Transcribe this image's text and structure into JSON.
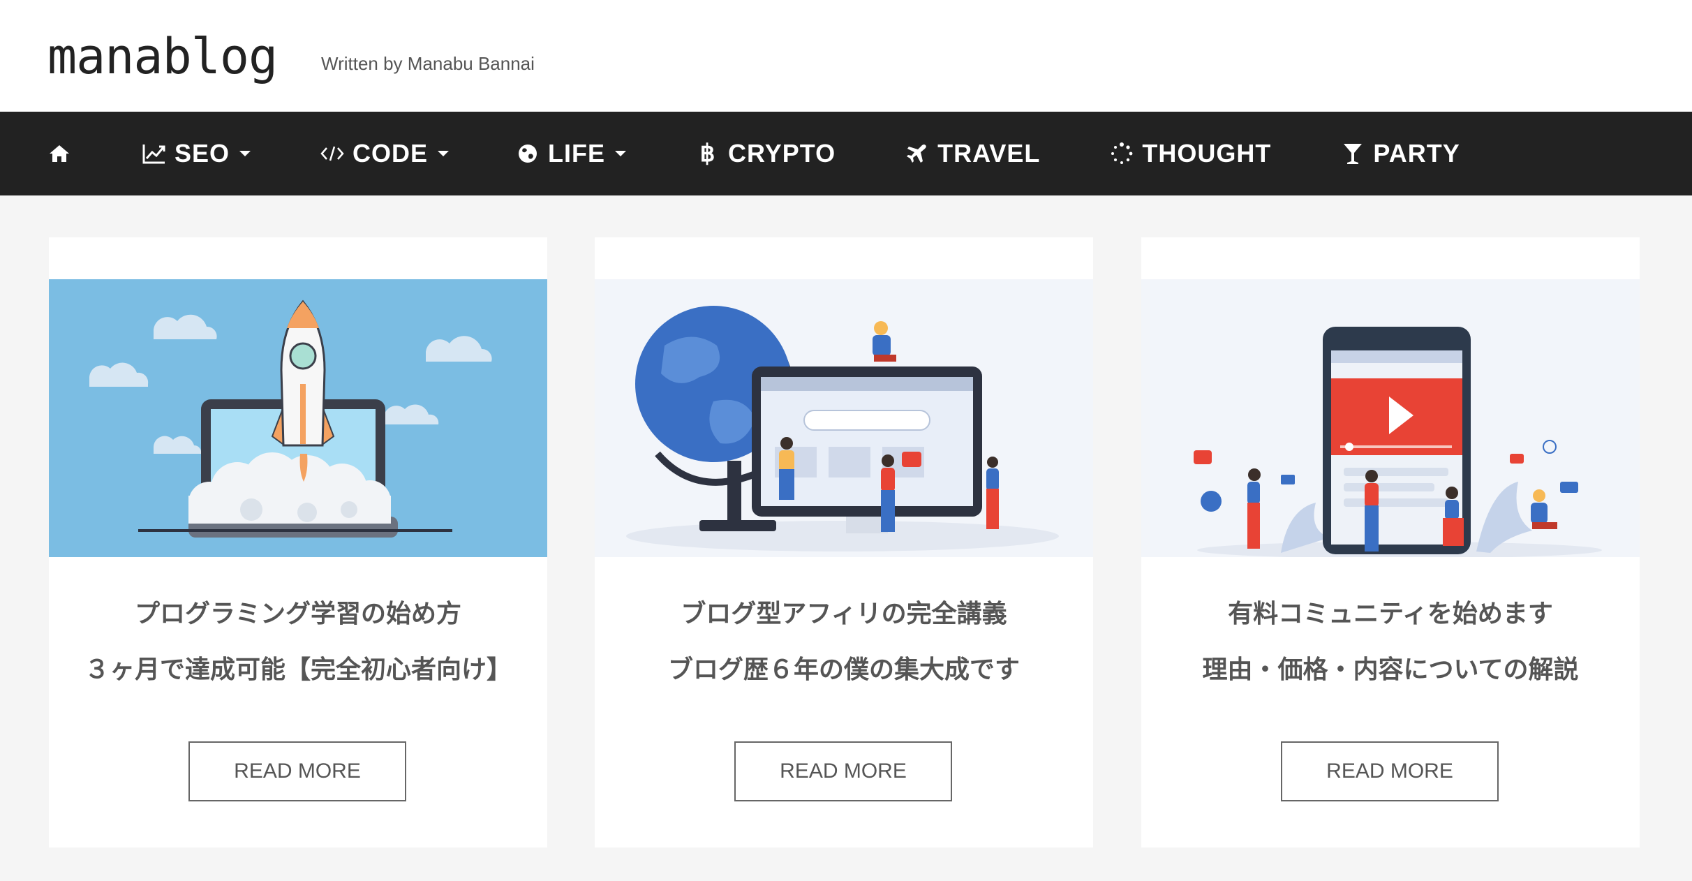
{
  "header": {
    "logo": "manablog",
    "tagline": "Written by Manabu Bannai"
  },
  "nav": {
    "items": [
      {
        "label": "",
        "icon": "home-icon"
      },
      {
        "label": "SEO",
        "icon": "chart-line-icon",
        "dropdown": true
      },
      {
        "label": "CODE",
        "icon": "code-icon",
        "dropdown": true
      },
      {
        "label": "LIFE",
        "icon": "globe-icon",
        "dropdown": true
      },
      {
        "label": "CRYPTO",
        "icon": "bitcoin-icon"
      },
      {
        "label": "TRAVEL",
        "icon": "plane-icon"
      },
      {
        "label": "THOUGHT",
        "icon": "spinner-icon"
      },
      {
        "label": "PARTY",
        "icon": "cocktail-icon"
      }
    ]
  },
  "posts": [
    {
      "title_line1": "プログラミング学習の始め方",
      "title_line2": "３ヶ月で達成可能【完全初心者向け】",
      "button": "READ MORE",
      "image": "rocket-laptop-illustration"
    },
    {
      "title_line1": "ブログ型アフィリの完全講義",
      "title_line2": "ブログ歴６年の僕の集大成です",
      "button": "READ MORE",
      "image": "globe-monitor-illustration"
    },
    {
      "title_line1": "有料コミュニティを始めます",
      "title_line2": "理由・価格・内容についての解説",
      "button": "READ MORE",
      "image": "smartphone-video-illustration"
    }
  ],
  "colors": {
    "nav_bg": "#222222",
    "page_bg": "#f5f5f5",
    "sky_blue": "#7bbde3",
    "accent_red": "#e84335"
  }
}
